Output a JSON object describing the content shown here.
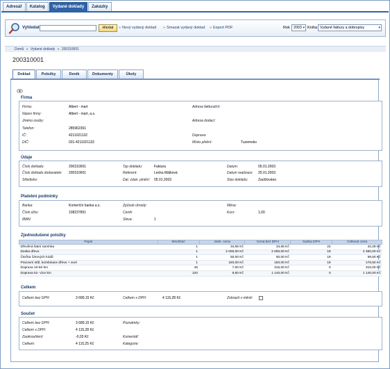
{
  "top_tabs": [
    "Adresář",
    "Katalog",
    "Vydané doklady",
    "Zakázky"
  ],
  "toolbar": {
    "search_label": "Vyhledat:",
    "search_value": "",
    "search_button": "Hledat",
    "links": [
      "Nový vydaný doklad",
      "Smazat vydaný doklad",
      "Export PDF"
    ],
    "year_label": "Rok",
    "year_value": "2003",
    "book_label": "Kniha",
    "book_value": "Vydané faktury a dobropisy"
  },
  "breadcrumb": [
    "Domů",
    "»",
    "Vydané doklady",
    "»",
    "200310001"
  ],
  "page_title": "200310001",
  "doc_tabs": [
    "Doklad",
    "Položky",
    "Deník",
    "Dokumenty",
    "Úkoly"
  ],
  "firma": {
    "title": "Firma",
    "labels": {
      "firma": "Firma:",
      "nazev": "Název firmy:",
      "osoba": "Jméno osoby:",
      "telefon": "Telefon:",
      "ic": "IČ:",
      "dic": "DIČ:",
      "adresa_fakt": "Adresa fakturační:",
      "adresa_dod": "Adresa dodací:",
      "doprava": "Doprava:",
      "misto": "Místo plnění:"
    },
    "values": {
      "firma": "Albert - mart",
      "nazev": "Albert - mart, a.s.",
      "telefon": "285962361",
      "ic": "4211021132",
      "dic": "031-4211021132",
      "misto": "Tuzemsko"
    }
  },
  "udaje": {
    "title": "Údaje",
    "labels": {
      "cislo": "Číslo dokladu:",
      "cislo_dod": "Číslo dokladu dodavatele:",
      "stredisko": "Středisko:",
      "typ": "Typ dokladu:",
      "referent": "Referent:",
      "dat_zdan": "Dat. zdan. plnění:",
      "datum": "Datum:",
      "datum_real": "Datum realizace:",
      "stav": "Stav dokladu:"
    },
    "values": {
      "cislo": "200310001",
      "cislo_dod": "200310001",
      "typ": "Faktura",
      "referent": "Lenka Málková",
      "dat_zdan": "05.01.2003",
      "datum": "05.01.2003",
      "datum_real": "25.01.2003",
      "stav": "Zaúčtováno"
    }
  },
  "platebni": {
    "title": "Platební podmínky",
    "labels": {
      "banka": "Banka:",
      "cislo_uctu": "Číslo účtu:",
      "iban": "IBAN:",
      "zpusob": "Způsob úhrady:",
      "cenik": "Ceník:",
      "sleva": "Sleva:",
      "mena": "Měna:",
      "kurs": "Kurs:"
    },
    "values": {
      "banka": "Komerční banka a.s.",
      "cislo_uctu": "108237851",
      "sleva": "1",
      "kurs": "1,00"
    }
  },
  "polozky": {
    "title": "Zjednodušené položky",
    "headers": [
      "Popis",
      "Množství",
      "Jedn. cena",
      "Cena bez DPH",
      "Sazba DPH",
      "Celková cena"
    ],
    "rows": [
      [
        "Dřevěná šatní ramínka",
        "1",
        "34,65 Kč",
        "34,65 Kč",
        "22",
        "42,28 Kč"
      ],
      [
        "Deska dřevo",
        "1",
        "2 000,00 Kč",
        "2 000,00 Kč",
        "19",
        "2 380,00 Kč"
      ],
      [
        "Čtečka čárových kódů",
        "1",
        "50,00 Kč",
        "50,00 Kč",
        "19",
        "59,50 Kč"
      ],
      [
        "Pracovní stůl, kombinace dřevo + ocel",
        "1",
        "150,00 Kč",
        "150,00 Kč",
        "19",
        "178,50 Kč"
      ],
      [
        "Doprava 10-50 km",
        "45",
        "7,00 Kč",
        "315,00 Kč",
        "0",
        "315,00 Kč"
      ],
      [
        "Doprava 51- více km",
        "120",
        "9,50 Kč",
        "1 140,00 Kč",
        "0",
        "1 140,00 Kč"
      ]
    ]
  },
  "celkem": {
    "title": "Celkem",
    "bez_dph_label": "Celkem bez DPH:",
    "bez_dph_value": "3 689,15 Kč",
    "s_dph_label": "Celkem s DPH:",
    "s_dph_value": "4 115,28 Kč",
    "zobrazit_label": "Zobrazit v měně:"
  },
  "soucet": {
    "title": "Součet",
    "labels": {
      "bez_dph": "Celkem bez DPH:",
      "s_dph": "Celkem s DPH:",
      "zaokrouhleni": "Zaokrouhlení:",
      "celkem": "Celkem:",
      "poznamky": "Poznámky:",
      "komentar": "Komentář:",
      "kategorie": "Kategorie:"
    },
    "values": {
      "bez_dph": "3 689,15 Kč",
      "s_dph": "4 115,28 Kč",
      "zaokrouhleni": "-0,03 Kč",
      "celkem": "4 115,25 Kč"
    }
  }
}
